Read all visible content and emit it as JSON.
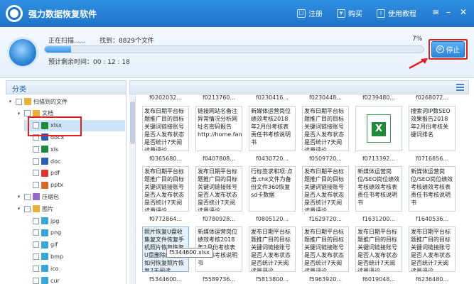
{
  "app": {
    "title": "强力数据恢复软件"
  },
  "titlebar": {
    "register": "注册",
    "buy": "购买",
    "help": "使用教程",
    "register_icon": "register-icon",
    "buy_icon": "cart-icon",
    "help_icon": "help-icon"
  },
  "scan": {
    "status": "正在扫描......",
    "found": "找到：8829个文件",
    "percent": "7%",
    "progress": 0.07,
    "remaining": "预计剩余时间：00 : 12 : 18",
    "stop": "停止"
  },
  "left_panel": {
    "header": "分类",
    "tree": [
      {
        "label": "扫描到的文件",
        "level": 0,
        "icon": "search-folder"
      },
      {
        "label": "文档",
        "level": 1,
        "icon": "folder"
      },
      {
        "label": "xlsx",
        "level": 2,
        "icon": "excel",
        "selected": true
      },
      {
        "label": "docx",
        "level": 2,
        "icon": "word"
      },
      {
        "label": "xls",
        "level": 2,
        "icon": "excel"
      },
      {
        "label": "doc",
        "level": 2,
        "icon": "word"
      },
      {
        "label": "pdf",
        "level": 2,
        "icon": "pdf"
      },
      {
        "label": "pptx",
        "level": 2,
        "icon": "ppt"
      },
      {
        "label": "压缩包",
        "level": 1,
        "icon": "archive"
      },
      {
        "label": "图片",
        "level": 1,
        "icon": "folder"
      },
      {
        "label": "jpg",
        "level": 2,
        "icon": "image"
      },
      {
        "label": "png",
        "level": 2,
        "icon": "image"
      },
      {
        "label": "gif",
        "level": 2,
        "icon": "image"
      },
      {
        "label": "bmp",
        "level": 2,
        "icon": "image"
      },
      {
        "label": "ico",
        "level": 2,
        "icon": "image"
      },
      {
        "label": "cur",
        "level": 2,
        "icon": "image"
      }
    ]
  },
  "grid": {
    "row_captions": [
      [
        "f0202032...",
        "f0213760...",
        "f0230416...",
        "f0230448...",
        "f0239480...",
        "f0268072..."
      ],
      [
        "f0365680...",
        "f0407808...",
        "f0430720...",
        "f0509720...",
        "f0713392...",
        "f0716856..."
      ],
      [
        "f0772864...",
        "f0780928...",
        "f0805120...",
        "f1629720...",
        "f1631200...",
        "f1640536..."
      ],
      [
        "f5344600...",
        "f5589736...",
        "f5813800...",
        "f5963920...",
        "f6019048...",
        "f6236480..."
      ]
    ],
    "thumbs": [
      [
        "发布日期平台标题推广目的目标关键词链接账号是否人发布状态是否统计7天阅读量评论",
        "链接网站名备注异常情况分析网址名密码报告http://home.fan",
        "新媒体运营岗位绩效考核2018年2月份考核表责任书考核说明书",
        "发布日期平台标题推广目的目标关键词链接账号是否人发布状态是否统计7天阅读量评论",
        "",
        "搜索词IP数SEO效果报告2018年2月份考核关键词排名"
      ],
      [
        "发布日期平台标题推广目的目标关键词链接账号是否人发布状态是否统计7天阅读量评论",
        "发布日期平台标题推广目的目标关键词链接账号是否人发布状态是否统计7天阅读量评论",
        "行标签求和项:点击.chk文件为备份文件360恢复sd卡数据",
        "发布日期平台标题推广目的目标关键词链接账号是否人发布状态是否统计7天阅读量评论",
        "新媒体运营岗位/SEO岗位绩效考核绩效考核表责任书考核说明书",
        "新媒体运营岗位/SEO岗位绩效考核绩效考核表责任书考核说明书"
      ],
      [
        "照片恢复U盘收集复文件恢复手机照片恢复恢复U盘删除的文件如何恢复照片恢复7天阅读",
        "新媒体运营岗位绩效考核2018年2月份考核表责任书考核说明书",
        "发布日期平台标题推广目的目标关键词链接账号是否人发布状态是否统计7天阅读量评论",
        "发布日期平台标题推广目的目标关键词链接账号是否人发布状态是否统计7天阅读量评论",
        "发布日期平台标题推广目的目标关键词链接账号是否人发布状态是否统计7天阅读量评论",
        "发布日期平台标题推广目的目标关键词链接账号是否人发布状态是否统计7天阅读量评论"
      ]
    ],
    "tooltip": "f5344600.xlsx"
  }
}
